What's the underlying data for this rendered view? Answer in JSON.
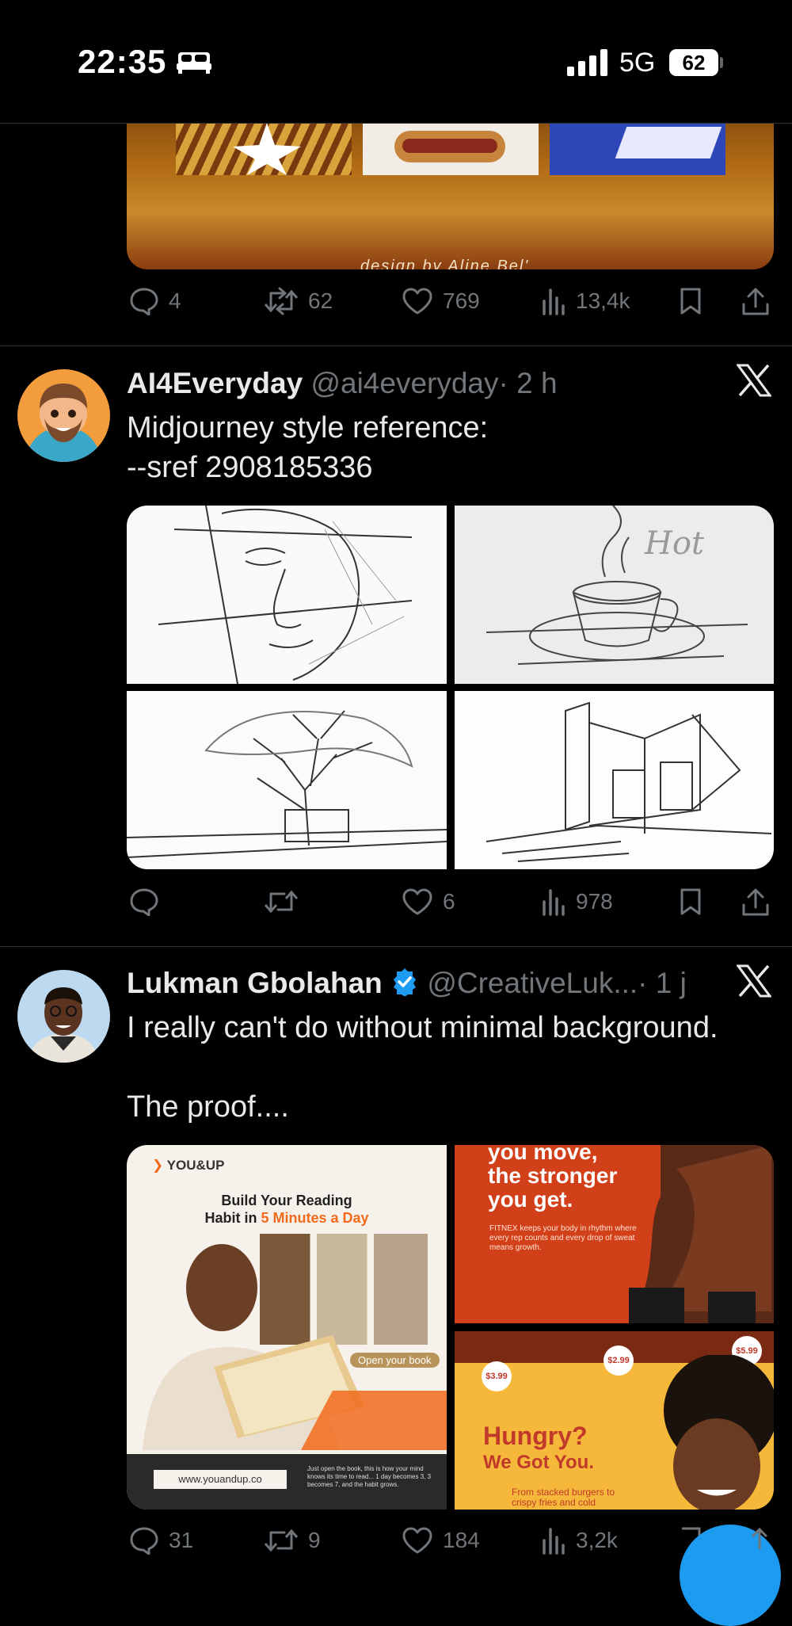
{
  "status_bar": {
    "time": "22:35",
    "network": "5G",
    "battery": "62"
  },
  "colors": {
    "background": "#000000",
    "text": "#e7e9ea",
    "muted": "#71767b",
    "verified": "#1d9bf0",
    "divider": "#2f3336"
  },
  "tweets": [
    {
      "media_caption": "design by Aline Bel'",
      "actions": {
        "replies": "4",
        "reposts": "62",
        "likes": "769",
        "views": "13,4k"
      }
    },
    {
      "name": "AI4Everyday",
      "handle": "@ai4everyday",
      "time": "· 2 h",
      "text": "Midjourney style reference:\n--sref 2908185336",
      "media": [
        "face-sketch",
        "coffee-cup-sketch",
        "tree-sketch",
        "house-sketch"
      ],
      "media_text": "Hot",
      "actions": {
        "replies": "",
        "reposts": "",
        "likes": "6",
        "views": "978"
      }
    },
    {
      "name": "Lukman Gbolahan",
      "verified": true,
      "handle": "@CreativeLuk...",
      "time": "· 1 j",
      "text": "I really can't do without minimal background.\n\nThe proof....",
      "media": {
        "poster1": {
          "brand": "YOU&UP",
          "headline": "Build Your Reading",
          "headline2": "Habit in ",
          "headline_accent": "5 Minutes a Day",
          "button": "Open your book",
          "url": "www.youandup.co",
          "footer": "Just open the book, this is how your mind knows its time to read... 1 day becomes 3, 3 becomes 7, and the habit grows."
        },
        "poster2": {
          "headline": "you move,\nthe stronger\nyou get.",
          "body": "FITNEX keeps your body in rhythm where every rep counts and every drop of sweat means growth."
        },
        "poster3": {
          "price1": "$3.99",
          "price2": "$2.99",
          "price3": "$5.99",
          "headline": "Hungry?",
          "headline2": "We Got You.",
          "body": "From stacked burgers to crispy fries and cold"
        }
      },
      "actions": {
        "replies": "31",
        "reposts": "9",
        "likes": "184",
        "views": "3,2k"
      }
    }
  ]
}
